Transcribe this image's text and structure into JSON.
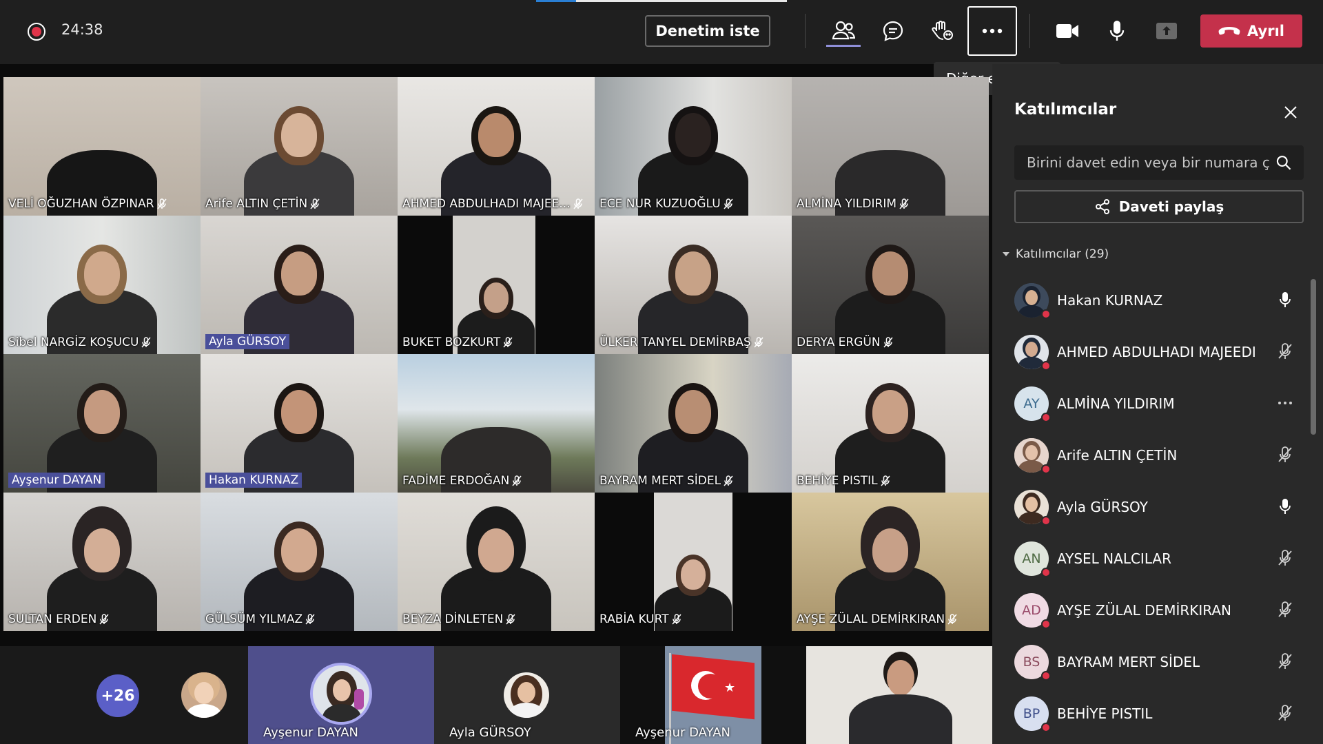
{
  "toolbar": {
    "timer": "24:38",
    "call_progress": 0.16,
    "review_label": "Denetim iste",
    "leave_label": "Ayrıl",
    "tooltip": "Diğer eylemler",
    "icons": [
      "people-icon",
      "chat-icon",
      "raise-hand-icon",
      "more-icon",
      "camera-icon",
      "mic-icon",
      "share-tray-icon",
      "phone-hangup-icon"
    ],
    "colors": {
      "leave": "#c4314b",
      "record": "#e0344a",
      "accent": "#5b5fc7"
    }
  },
  "grid": {
    "tiles": [
      {
        "name": "VELİ OĞUZHAN ÖZPINAR",
        "muted": true
      },
      {
        "name": "Arife ALTIN ÇETİN",
        "muted": true
      },
      {
        "name": "AHMED ABDULHADI MAJEE...",
        "muted": true
      },
      {
        "name": "ECE NUR KUZUOĞLU",
        "muted": true
      },
      {
        "name": "ALMİNA YILDIRIM",
        "muted": true
      },
      {
        "name": "Sibel NARGİZ KOŞUCU",
        "muted": true
      },
      {
        "name": "Ayla GÜRSOY",
        "muted": false
      },
      {
        "name": "BUKET BOZKURT",
        "muted": true
      },
      {
        "name": "ÜLKER TANYEL DEMİRBAŞ",
        "muted": true
      },
      {
        "name": "DERYA ERGÜN",
        "muted": true
      },
      {
        "name": "Ayşenur DAYAN",
        "muted": false
      },
      {
        "name": "Hakan KURNAZ",
        "muted": false
      },
      {
        "name": "FADİME ERDOĞAN",
        "muted": true
      },
      {
        "name": "BAYRAM MERT SİDEL",
        "muted": true
      },
      {
        "name": "BEHİYE PISTIL",
        "muted": true
      },
      {
        "name": "SULTAN ERDEN",
        "muted": true
      },
      {
        "name": "GÜLSÜM YILMAZ",
        "muted": true
      },
      {
        "name": "BEYZA DİNLETEN",
        "muted": true
      },
      {
        "name": "RABİA KURT",
        "muted": true
      },
      {
        "name": "AYŞE ZÜLAL DEMİRKIRAN",
        "muted": true
      }
    ]
  },
  "strip": {
    "overflow": "+26",
    "tiles": [
      {
        "label": "Ayşenur DAYAN"
      },
      {
        "label": "Ayla GÜRSOY"
      },
      {
        "label": "Ayşenur DAYAN"
      }
    ]
  },
  "panel": {
    "title": "Katılımcılar",
    "search_placeholder": "Birini davet edin veya bir numara çevirin",
    "share_label": "Daveti paylaş",
    "section_label": "Katılımcılar (29)",
    "participants": [
      {
        "name": "Hakan KURNAZ",
        "initials": "",
        "status": "mic-on"
      },
      {
        "name": "AHMED ABDULHADI MAJEEDI",
        "initials": "",
        "status": "mic-off"
      },
      {
        "name": "ALMİNA YILDIRIM",
        "initials": "AY",
        "status": "more"
      },
      {
        "name": "Arife ALTIN ÇETİN",
        "initials": "",
        "status": "mic-off"
      },
      {
        "name": "Ayla GÜRSOY",
        "initials": "",
        "status": "mic-on"
      },
      {
        "name": "AYSEL NALCILAR",
        "initials": "AN",
        "status": "mic-off"
      },
      {
        "name": "AYŞE ZÜLAL DEMİRKIRAN",
        "initials": "AD",
        "status": "mic-off"
      },
      {
        "name": "BAYRAM MERT SİDEL",
        "initials": "BS",
        "status": "mic-off"
      },
      {
        "name": "BEHİYE PISTIL",
        "initials": "BP",
        "status": "mic-off"
      }
    ]
  }
}
